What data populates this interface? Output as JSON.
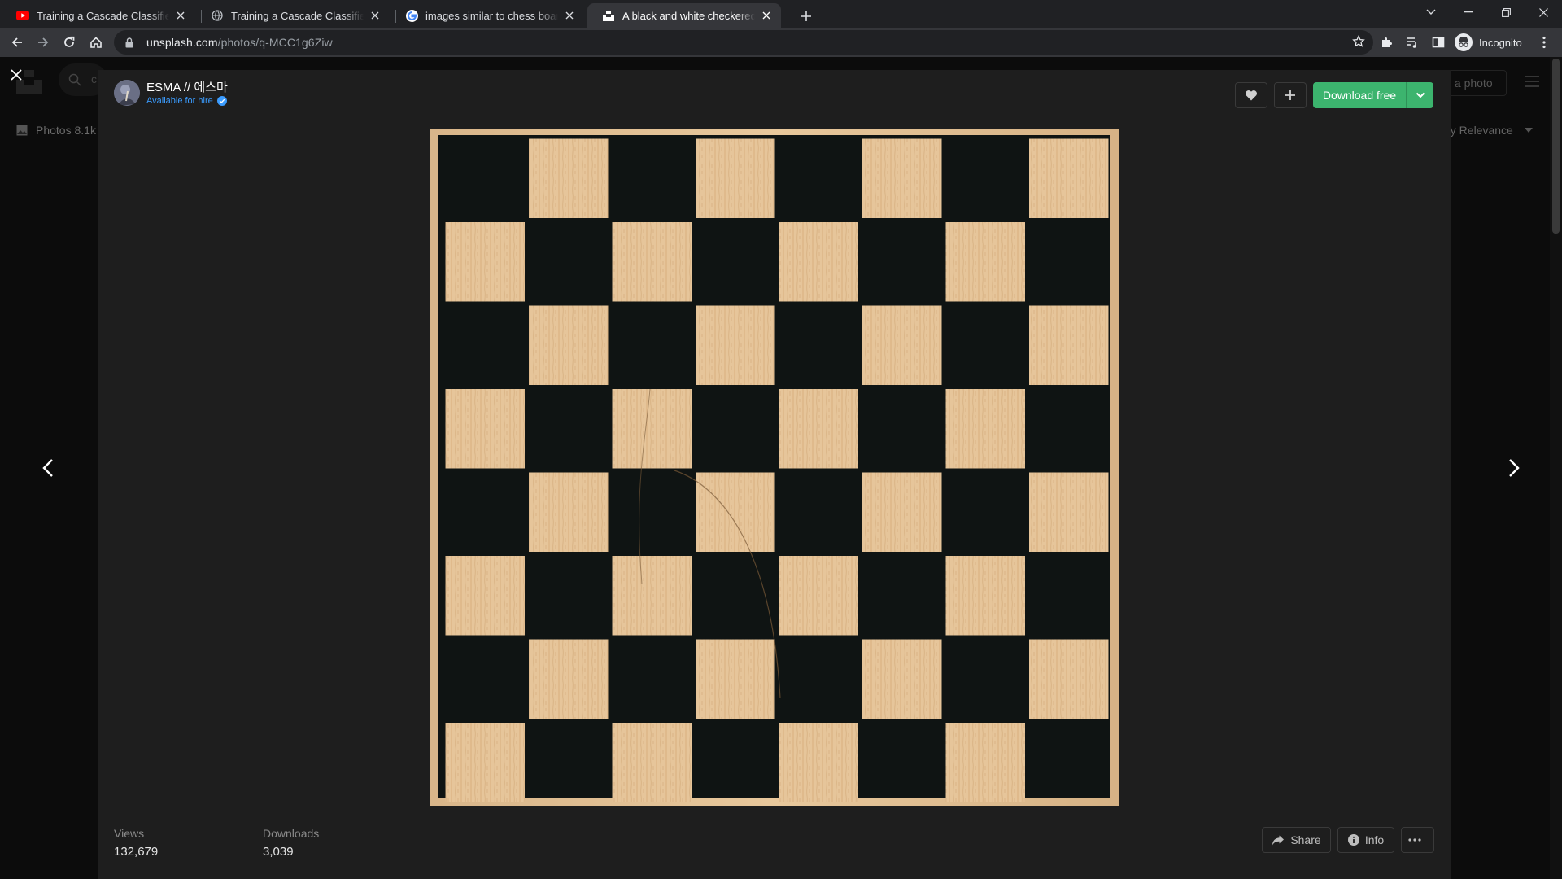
{
  "browser": {
    "tabs": [
      {
        "title": "Training a Cascade Classifier - Op",
        "favicon": "youtube-icon",
        "active": false
      },
      {
        "title": "Training a Cascade Classifier - Le",
        "favicon": "globe-icon",
        "active": false
      },
      {
        "title": "images similar to chess board - G",
        "favicon": "google-icon",
        "active": false
      },
      {
        "title": "A black and white checkered boa",
        "favicon": "unsplash-icon",
        "active": true
      }
    ],
    "url_host": "unsplash.com",
    "url_path": "/photos/q-MCC1g6Ziw",
    "profile_label": "Incognito"
  },
  "background": {
    "search_placeholder": "c",
    "submit_label": "it a photo",
    "photos_tab": "Photos 8.1k",
    "sort_label": "by Relevance"
  },
  "modal": {
    "author_name": "ESMA // 에스마",
    "author_status": "Available for hire",
    "download_label": "Download free",
    "photo_alt": "A black and white checkered board",
    "stats": [
      {
        "label": "Views",
        "value": "132,679"
      },
      {
        "label": "Downloads",
        "value": "3,039"
      }
    ],
    "share_label": "Share",
    "info_label": "Info"
  },
  "colors": {
    "accent_green": "#3cb46e",
    "link_blue": "#3b9cff",
    "modal_bg": "#1e1e1e",
    "board_dark": "#0f1413",
    "board_light": "#e7c79c"
  }
}
